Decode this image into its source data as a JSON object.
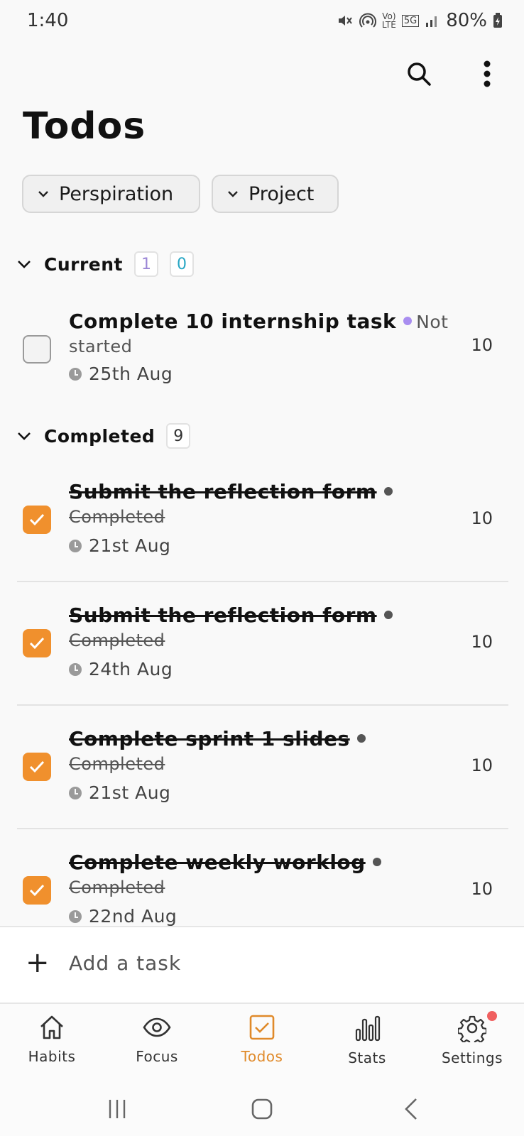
{
  "status_bar": {
    "time": "1:40",
    "battery": "80%",
    "network": "5G"
  },
  "header": {
    "title": "Todos"
  },
  "filters": [
    {
      "label": "Perspiration"
    },
    {
      "label": "Project"
    }
  ],
  "sections": {
    "current": {
      "title": "Current",
      "count_a": "1",
      "count_b": "0"
    },
    "completed": {
      "title": "Completed",
      "count": "9"
    }
  },
  "current_tasks": [
    {
      "title_line1": "Complete 10 internship task",
      "status_word1": "Not",
      "title_line2": "started",
      "date": "25th Aug",
      "points": "10"
    }
  ],
  "completed_tasks": [
    {
      "title": "Submit the reflection form",
      "status": "Completed",
      "date": "21st Aug",
      "points": "10"
    },
    {
      "title": "Submit the reflection form",
      "status": "Completed",
      "date": "24th Aug",
      "points": "10"
    },
    {
      "title": "Complete sprint 1 slides",
      "status": "Completed",
      "date": "21st Aug",
      "points": "10"
    },
    {
      "title": "Complete weekly worklog",
      "status": "Completed",
      "date": "22nd Aug",
      "points": "10"
    }
  ],
  "add_task": {
    "label": "Add a task"
  },
  "nav": [
    {
      "label": "Habits",
      "icon": "home-icon"
    },
    {
      "label": "Focus",
      "icon": "eye-icon"
    },
    {
      "label": "Todos",
      "icon": "checkbox-icon",
      "active": true
    },
    {
      "label": "Stats",
      "icon": "bar-chart-icon"
    },
    {
      "label": "Settings",
      "icon": "gear-icon"
    }
  ],
  "colors": {
    "accent": "#f0902d",
    "not_started_dot": "#a98ef0",
    "count_purple": "#9b86d6",
    "count_teal": "#26a6c4"
  }
}
